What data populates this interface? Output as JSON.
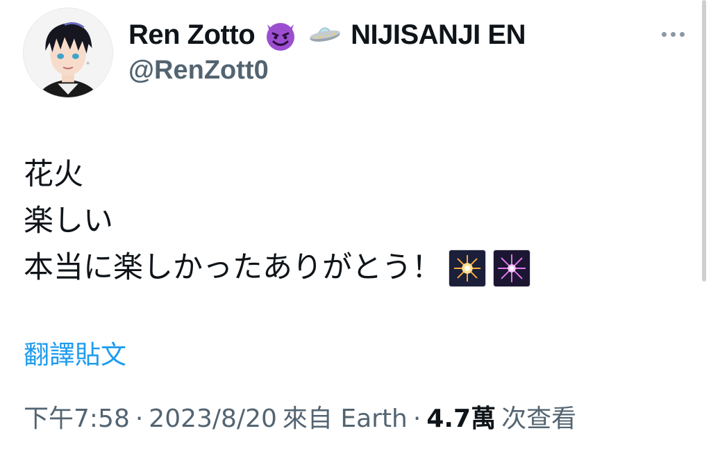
{
  "author": {
    "display_name": "Ren Zotto",
    "name_suffix": "NIJISANJI EN",
    "handle": "@RenZott0",
    "avatar_icon": "avatar-anime-boy-icon",
    "name_emojis": [
      "smiling-devil-emoji-icon",
      "flying-saucer-emoji-icon"
    ]
  },
  "tweet": {
    "lines": [
      "花火",
      "楽しい",
      "本当に楽しかったありがとう！"
    ],
    "trailing_emojis": [
      "fireworks-emoji-icon",
      "sparkler-emoji-icon"
    ]
  },
  "translate_label": "翻譯貼文",
  "meta": {
    "time": "下午7:58",
    "separator": "·",
    "date": "2023/8/20",
    "source": "來自 Earth",
    "views_count": "4.7萬",
    "views_label": "次查看"
  },
  "colors": {
    "text": "#0f1419",
    "muted": "#536471",
    "link": "#1d9bf0",
    "devil_purple": "#9b4fd0"
  }
}
